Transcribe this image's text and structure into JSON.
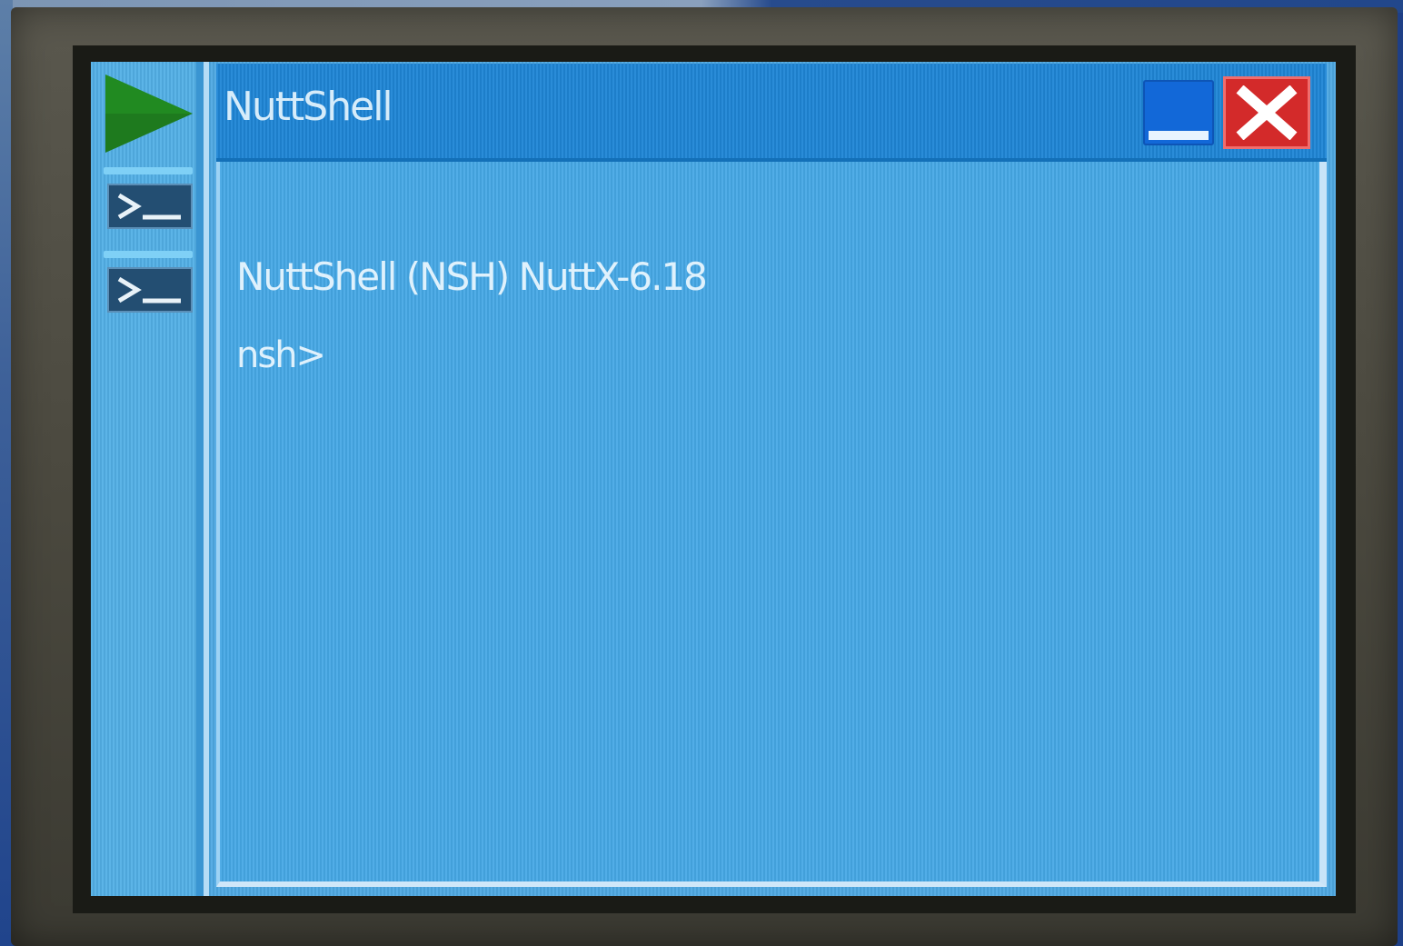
{
  "window": {
    "title": "NuttShell"
  },
  "terminal": {
    "lines": [
      "NuttShell (NSH) NuttX-6.18",
      "nsh>"
    ]
  },
  "taskbar": {
    "start_icon": "play-triangle-icon",
    "tasks": [
      {
        "icon": "terminal-prompt-icon"
      },
      {
        "icon": "terminal-prompt-icon"
      }
    ]
  },
  "colors": {
    "screen_background": "#4ea8e2",
    "titlebar": "#1f86d6",
    "start_icon": "#1e7a1e",
    "close_button": "#d32a2a",
    "minimize_button": "#1268d8"
  }
}
